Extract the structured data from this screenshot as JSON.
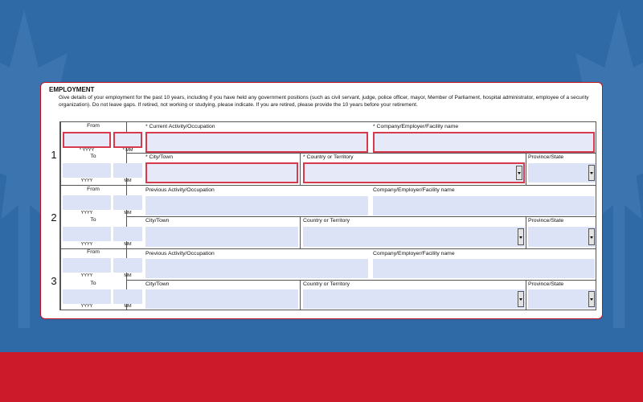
{
  "section_title": "EMPLOYMENT",
  "instructions": "Give details of your employment for the past 10 years, including if you have held any government positions (such as civil servant, judge, police officer, mayor, Member of Parliament, hospital administrator, employee of a security organization).  Do not leave gaps.   If retired, not working or studying, please indicate.  If you are retired, please provide the 10 years before your retirement.",
  "rows": [
    {
      "num": "1",
      "from_label": "From",
      "from_yyyy": "* YYYY",
      "from_mm": "* MM",
      "to_label": "To",
      "to_yyyy": "YYYY",
      "to_mm": "MM",
      "activity_label": "* Current Activity/Occupation",
      "employer_label": "* Company/Employer/Facility name",
      "city_label": "* City/Town",
      "country_label": "* Country or Territory",
      "province_label": "Province/State"
    },
    {
      "num": "2",
      "from_label": "From",
      "from_yyyy": "YYYY",
      "from_mm": "MM",
      "to_label": "To",
      "to_yyyy": "YYYY",
      "to_mm": "MM",
      "activity_label": "Previous Activity/Occupation",
      "employer_label": "Company/Employer/Facility name",
      "city_label": "City/Town",
      "country_label": "Country or Territory",
      "province_label": "Province/State"
    },
    {
      "num": "3",
      "from_label": "From",
      "from_yyyy": "YYYY",
      "from_mm": "MM",
      "to_label": "To",
      "to_yyyy": "YYYY",
      "to_mm": "MM",
      "activity_label": "Previous Activity/Occupation",
      "employer_label": "Company/Employer/Facility name",
      "city_label": "City/Town",
      "country_label": "Country or Territory",
      "province_label": "Province/State"
    }
  ],
  "colors": {
    "background_blue": "#2f6aa7",
    "band_red": "#cc1a2b",
    "required_border": "#d63a4c",
    "field_fill": "#dde3f7"
  },
  "icons": [
    "maple-leaf-icon",
    "dropdown-arrow-icon"
  ]
}
